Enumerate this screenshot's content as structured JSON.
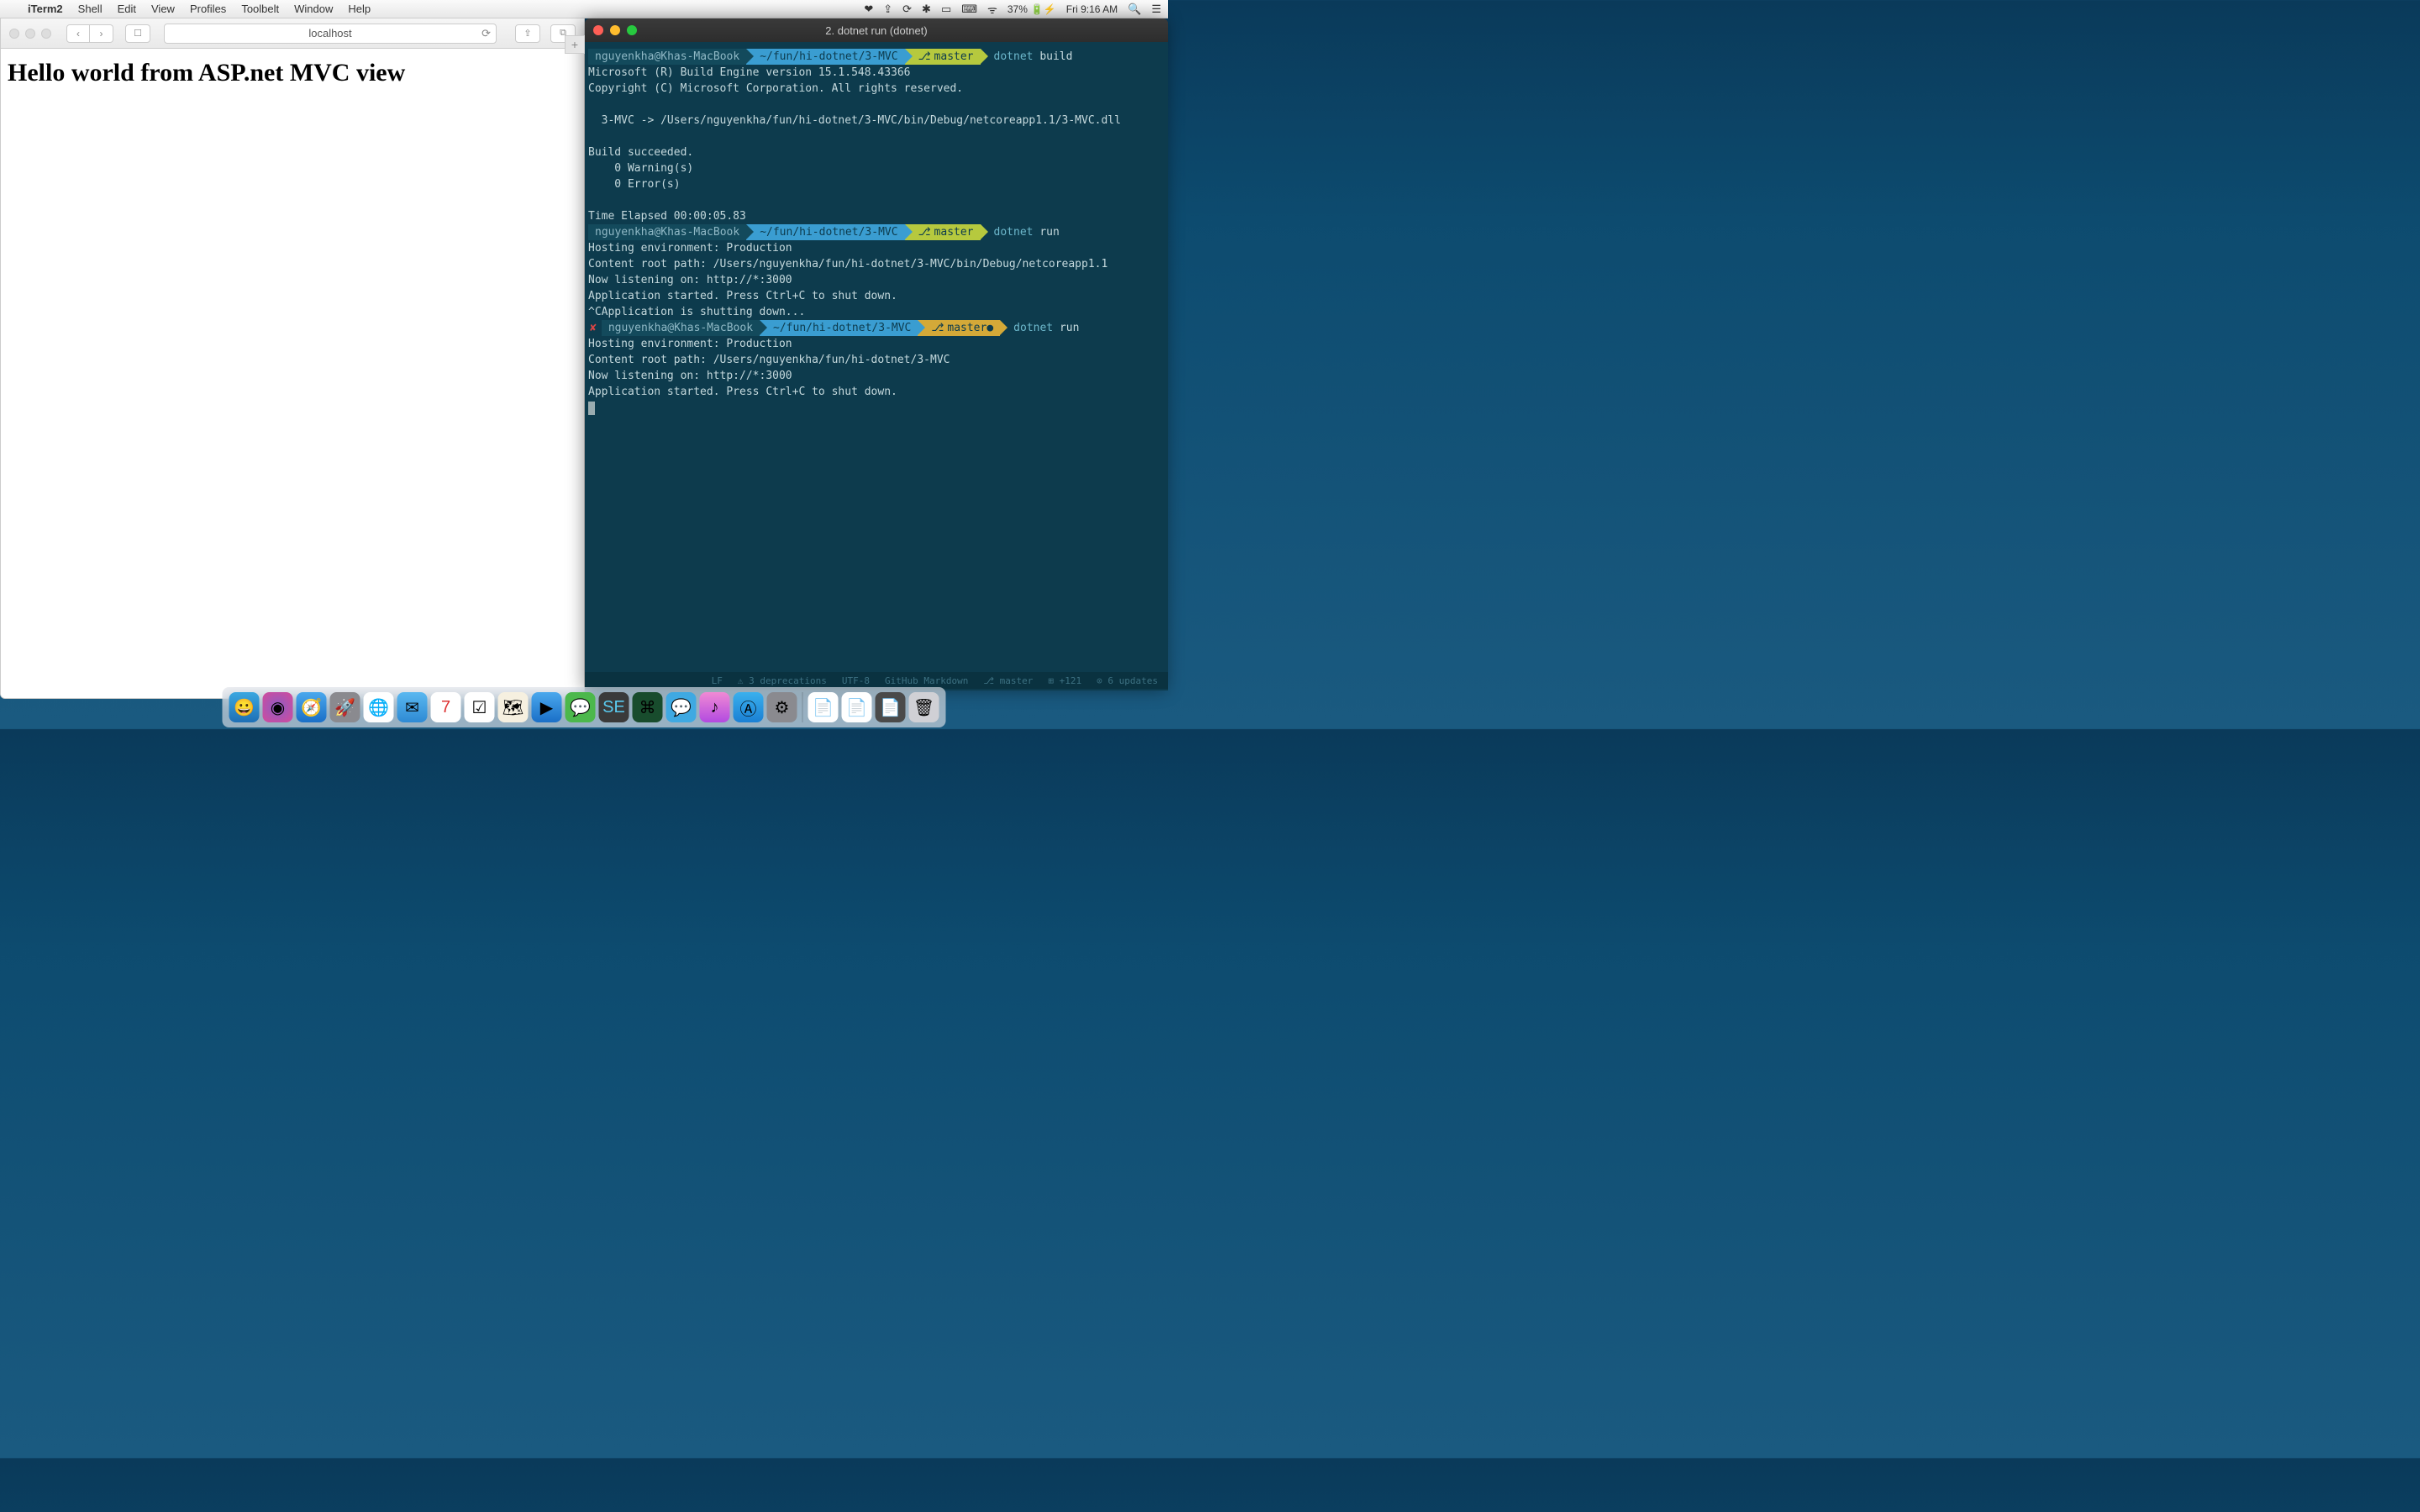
{
  "menubar": {
    "app": "iTerm2",
    "items": [
      "Shell",
      "Edit",
      "View",
      "Profiles",
      "Toolbelt",
      "Window",
      "Help"
    ],
    "battery_pct": "37%",
    "clock": "Fri 9:16 AM"
  },
  "safari": {
    "url": "localhost",
    "page_heading": "Hello world from ASP.net MVC view"
  },
  "iterm": {
    "title": "2. dotnet run (dotnet)",
    "prompt_user": "nguyenkha@Khas-MacBook",
    "prompt_path": "~/fun/hi-dotnet/3-MVC",
    "git_branch": "master",
    "cmd1_bin": "dotnet",
    "cmd1_arg": "build",
    "cmd2_bin": "dotnet",
    "cmd2_arg": "run",
    "cmd3_bin": "dotnet",
    "cmd3_arg": "run",
    "lines_build": [
      "Microsoft (R) Build Engine version 15.1.548.43366",
      "Copyright (C) Microsoft Corporation. All rights reserved.",
      "",
      "  3-MVC -> /Users/nguyenkha/fun/hi-dotnet/3-MVC/bin/Debug/netcoreapp1.1/3-MVC.dll",
      "",
      "Build succeeded.",
      "    0 Warning(s)",
      "    0 Error(s)",
      "",
      "Time Elapsed 00:00:05.83"
    ],
    "lines_run1": [
      "Hosting environment: Production",
      "Content root path: /Users/nguyenkha/fun/hi-dotnet/3-MVC/bin/Debug/netcoreapp1.1",
      "Now listening on: http://*:3000",
      "Application started. Press Ctrl+C to shut down.",
      "^CApplication is shutting down..."
    ],
    "lines_run2": [
      "Hosting environment: Production",
      "Content root path: /Users/nguyenkha/fun/hi-dotnet/3-MVC",
      "Now listening on: http://*:3000",
      "Application started. Press Ctrl+C to shut down."
    ],
    "git_dirty_dot": "●"
  },
  "editor_status": {
    "lf": "LF",
    "deprecations": "⚠ 3 deprecations",
    "encoding": "UTF-8",
    "grammar": "GitHub Markdown",
    "branch": "⎇ master",
    "pos": "⊞ +121",
    "updates": "⊙ 6 updates"
  },
  "dock_icons": [
    "finder",
    "siri",
    "safari",
    "launchpad",
    "chrome",
    "mail",
    "calendar",
    "reminders",
    "maps",
    "messages",
    "skype",
    "vscode",
    "spotify",
    "terminal-a",
    "terminal-b",
    "chat",
    "itunes",
    "appstore",
    "settings",
    "doc1",
    "doc2",
    "doc3",
    "trash"
  ]
}
